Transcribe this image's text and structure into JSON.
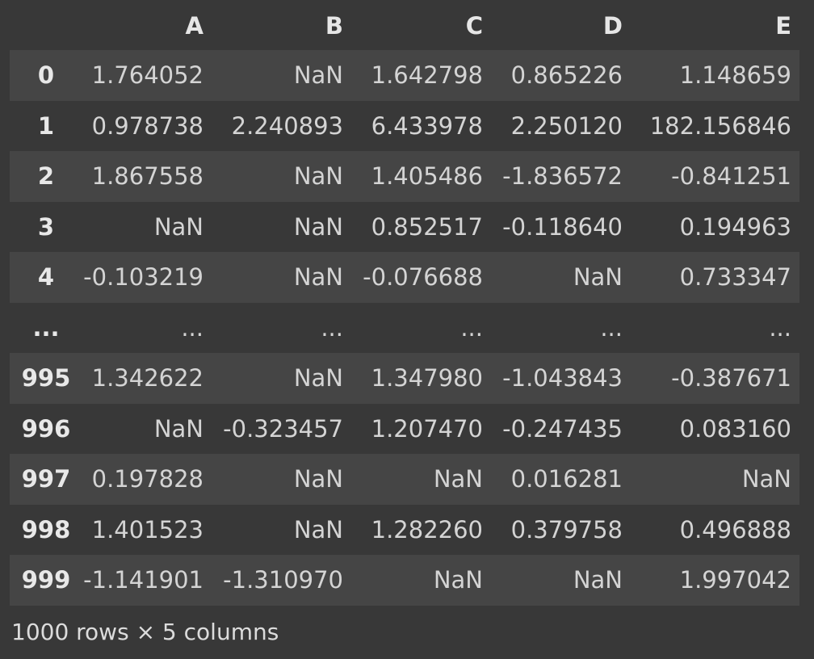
{
  "table": {
    "corner": "",
    "columns": [
      "A",
      "B",
      "C",
      "D",
      "E"
    ],
    "rows": [
      {
        "index": "0",
        "cells": [
          "1.764052",
          "NaN",
          "1.642798",
          "0.865226",
          "1.148659"
        ]
      },
      {
        "index": "1",
        "cells": [
          "0.978738",
          "2.240893",
          "6.433978",
          "2.250120",
          "182.156846"
        ]
      },
      {
        "index": "2",
        "cells": [
          "1.867558",
          "NaN",
          "1.405486",
          "-1.836572",
          "-0.841251"
        ]
      },
      {
        "index": "3",
        "cells": [
          "NaN",
          "NaN",
          "0.852517",
          "-0.118640",
          "0.194963"
        ]
      },
      {
        "index": "4",
        "cells": [
          "-0.103219",
          "NaN",
          "-0.076688",
          "NaN",
          "0.733347"
        ]
      },
      {
        "index": "...",
        "cells": [
          "...",
          "...",
          "...",
          "...",
          "..."
        ]
      },
      {
        "index": "995",
        "cells": [
          "1.342622",
          "NaN",
          "1.347980",
          "-1.043843",
          "-0.387671"
        ]
      },
      {
        "index": "996",
        "cells": [
          "NaN",
          "-0.323457",
          "1.207470",
          "-0.247435",
          "0.083160"
        ]
      },
      {
        "index": "997",
        "cells": [
          "0.197828",
          "NaN",
          "NaN",
          "0.016281",
          "NaN"
        ]
      },
      {
        "index": "998",
        "cells": [
          "1.401523",
          "NaN",
          "1.282260",
          "0.379758",
          "0.496888"
        ]
      },
      {
        "index": "999",
        "cells": [
          "-1.141901",
          "-1.310970",
          "NaN",
          "NaN",
          "1.997042"
        ]
      }
    ]
  },
  "footer": {
    "shape_text": "1000 rows × 5 columns"
  },
  "colors": {
    "background": "#383838",
    "stripe": "#454545",
    "text": "#dcdcdc"
  }
}
